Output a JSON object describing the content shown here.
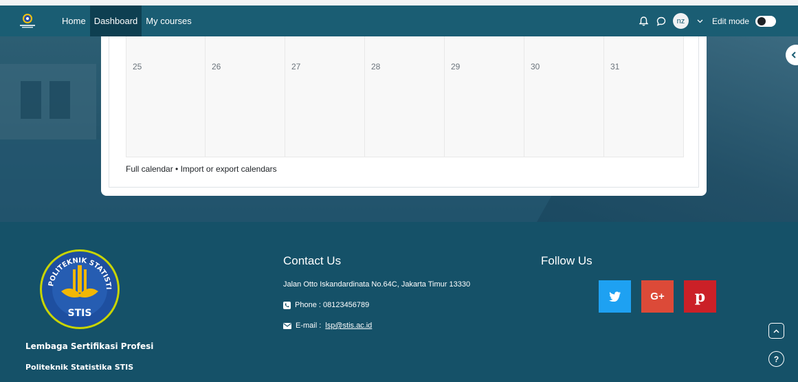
{
  "nav": {
    "links": [
      "Home",
      "Dashboard",
      "My courses"
    ],
    "avatar_initials": "nz",
    "edit_mode_label": "Edit mode"
  },
  "calendar": {
    "last_week_days": [
      "25",
      "26",
      "27",
      "28",
      "29",
      "30",
      "31"
    ],
    "link_full": "Full calendar",
    "separator": "•",
    "link_import": "Import or export calendars"
  },
  "footer": {
    "logo_text_top": "POLITEKNIK STATISTIKA",
    "logo_text_bottom": "STIS",
    "org_line1": "Lembaga Sertifikasi Profesi",
    "org_line2": "Politeknik Statistika STIS",
    "contact_heading": "Contact Us",
    "address": "Jalan Otto Iskandardinata No.64C, Jakarta Timur 13330",
    "phone": "Phone : 08123456789",
    "email_label": "E-mail :",
    "email": "lsp@stis.ac.id",
    "follow_heading": "Follow Us",
    "social": [
      "twitter-icon",
      "google-plus-icon",
      "pinterest-icon"
    ],
    "social_glyphs": {
      "google": "G+",
      "pinterest": "p"
    }
  },
  "colors": {
    "navbar": "#1a5d73",
    "footer": "#155168",
    "twitter": "#1ea1f2",
    "google": "#dc4a38",
    "pinterest": "#cb2027"
  }
}
